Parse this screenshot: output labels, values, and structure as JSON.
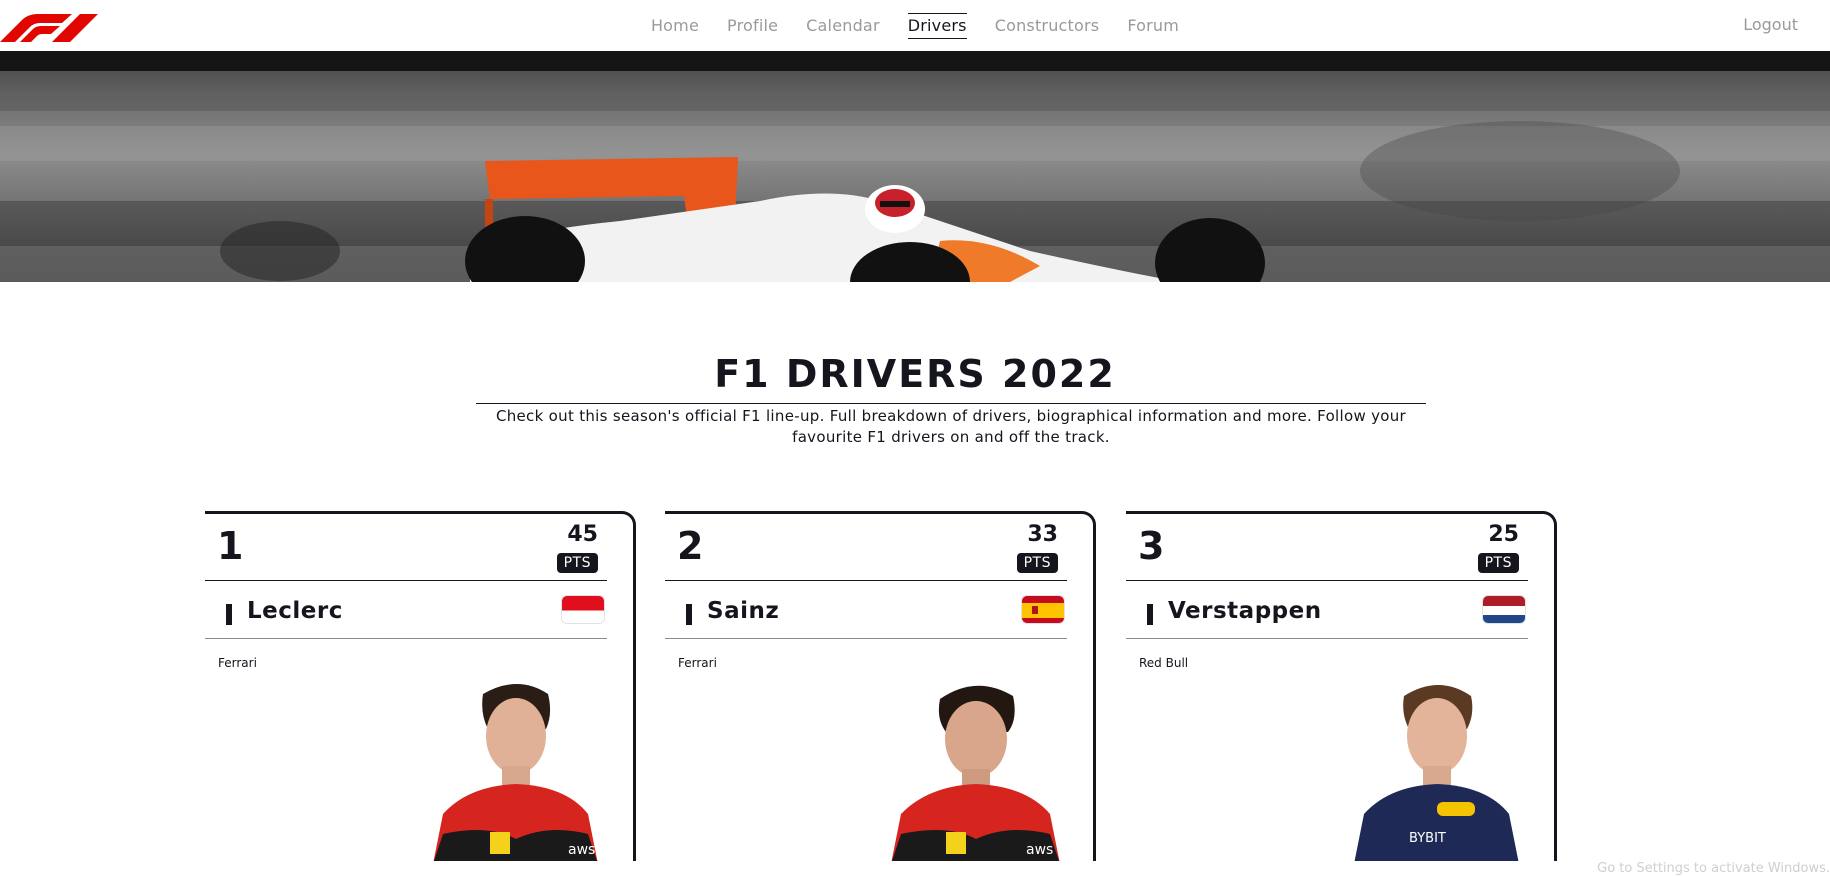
{
  "nav": {
    "links": [
      {
        "label": "Home",
        "active": false
      },
      {
        "label": "Profile",
        "active": false
      },
      {
        "label": "Calendar",
        "active": false
      },
      {
        "label": "Drivers",
        "active": true
      },
      {
        "label": "Constructors",
        "active": false
      },
      {
        "label": "Forum",
        "active": false
      }
    ],
    "logout_label": "Logout"
  },
  "page": {
    "title": "F1 DRIVERS 2022",
    "subtitle": "Check out this season's official F1 line-up. Full breakdown of drivers, biographical information and more. Follow your favourite F1 drivers on and off the track."
  },
  "drivers": [
    {
      "rank": "1",
      "points": "45",
      "points_label": "PTS",
      "name": "Leclerc",
      "team": "Ferrari",
      "flag": "monaco-flag",
      "suit_color": "#d5251e"
    },
    {
      "rank": "2",
      "points": "33",
      "points_label": "PTS",
      "name": "Sainz",
      "team": "Ferrari",
      "flag": "spain-flag",
      "suit_color": "#d5251e"
    },
    {
      "rank": "3",
      "points": "25",
      "points_label": "PTS",
      "name": "Verstappen",
      "team": "Red Bull",
      "flag": "netherlands-flag",
      "suit_color": "#1e2a55"
    }
  ],
  "colors": {
    "brand": "#e10600",
    "text": "#15151e",
    "nav_inactive": "#9a9a9a"
  },
  "watermark": "Go to Settings to activate Windows."
}
